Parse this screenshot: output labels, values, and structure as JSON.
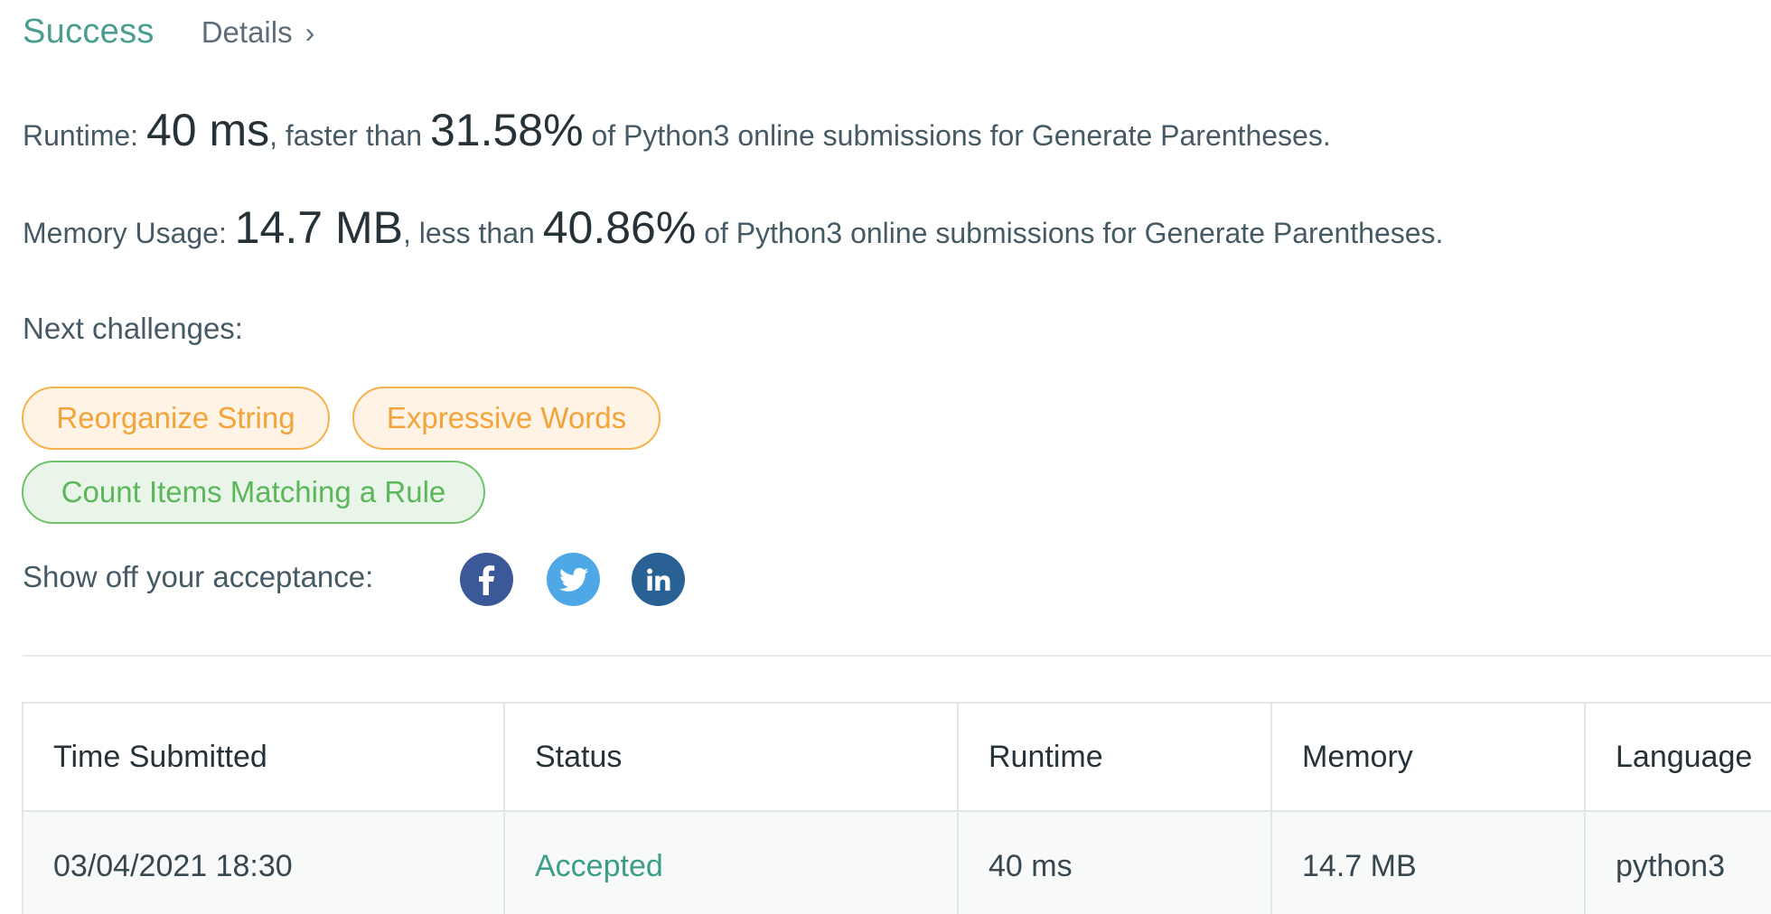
{
  "header": {
    "status": "Success",
    "details_label": "Details",
    "details_chevron": "›"
  },
  "stats": {
    "runtime": {
      "label": "Runtime: ",
      "value": "40 ms",
      "comparator": ", faster than ",
      "percent": "31.58%",
      "suffix": " of Python3 online submissions for Generate Parentheses."
    },
    "memory": {
      "label": "Memory Usage: ",
      "value": "14.7 MB",
      "comparator": ", less than ",
      "percent": "40.86%",
      "suffix": " of Python3 online submissions for Generate Parentheses."
    }
  },
  "next": {
    "label": "Next challenges:",
    "challenges": [
      {
        "title": "Reorganize String",
        "difficulty": "medium",
        "color": "#f2a43b"
      },
      {
        "title": "Expressive Words",
        "difficulty": "medium",
        "color": "#f2a43b"
      },
      {
        "title": "Count Items Matching a Rule",
        "difficulty": "easy",
        "color": "#5cb65a"
      }
    ]
  },
  "share": {
    "label": "Show off your acceptance:",
    "icons": [
      {
        "name": "facebook-icon",
        "color": "#3b5998"
      },
      {
        "name": "twitter-icon",
        "color": "#4fa8e6"
      },
      {
        "name": "linkedin-icon",
        "color": "#2a6195"
      }
    ]
  },
  "table": {
    "headers": [
      "Time Submitted",
      "Status",
      "Runtime",
      "Memory",
      "Language"
    ],
    "rows": [
      {
        "time": "03/04/2021 18:30",
        "status": "Accepted",
        "runtime": "40 ms",
        "memory": "14.7 MB",
        "language": "python3"
      }
    ]
  },
  "colors": {
    "success": "#4a9d8f",
    "accepted": "#3c9d88"
  }
}
